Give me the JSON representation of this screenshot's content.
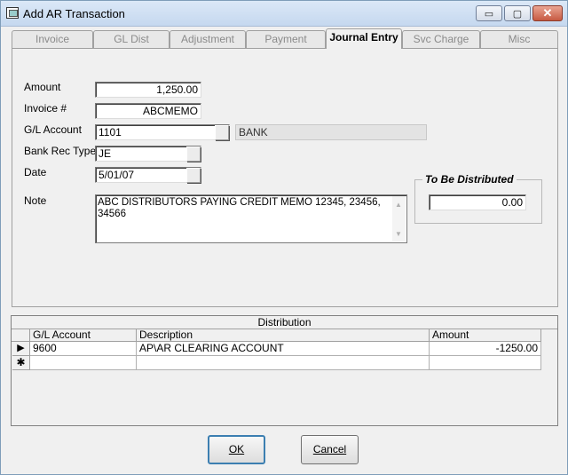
{
  "window": {
    "title": "Add AR Transaction"
  },
  "titlebar": {
    "minimize_glyph": "▭",
    "maximize_glyph": "▢",
    "close_glyph": "✕"
  },
  "tabs": [
    {
      "label": "Invoice"
    },
    {
      "label": "GL Dist"
    },
    {
      "label": "Adjustment"
    },
    {
      "label": "Payment"
    },
    {
      "label": "Journal Entry",
      "active": true
    },
    {
      "label": "Svc Charge"
    },
    {
      "label": "Misc"
    }
  ],
  "form": {
    "amount_label": "Amount",
    "amount_value": "1,250.00",
    "invoice_label": "Invoice #",
    "invoice_value": "ABCMEMO",
    "gl_account_label": "G/L Account",
    "gl_account_value": "1101",
    "gl_account_desc": "BANK",
    "bank_rec_type_label": "Bank Rec Type",
    "bank_rec_type_value": "JE",
    "date_label": "Date",
    "date_value": "5/01/07",
    "note_label": "Note",
    "note_value": "ABC DISTRIBUTORS PAYING CREDIT MEMO 12345, 23456, 34566"
  },
  "to_be_distributed": {
    "title": "To Be Distributed",
    "value": "0.00"
  },
  "distribution": {
    "caption": "Distribution",
    "columns": [
      "G/L Account",
      "Description",
      "Amount"
    ],
    "rows": [
      {
        "selector": "▶",
        "gl_account": "9600",
        "description": "AP\\AR CLEARING ACCOUNT",
        "amount": "-1250.00"
      }
    ],
    "new_row_selector": "✱"
  },
  "buttons": {
    "ok_label": "OK",
    "cancel_label": "Cancel"
  }
}
